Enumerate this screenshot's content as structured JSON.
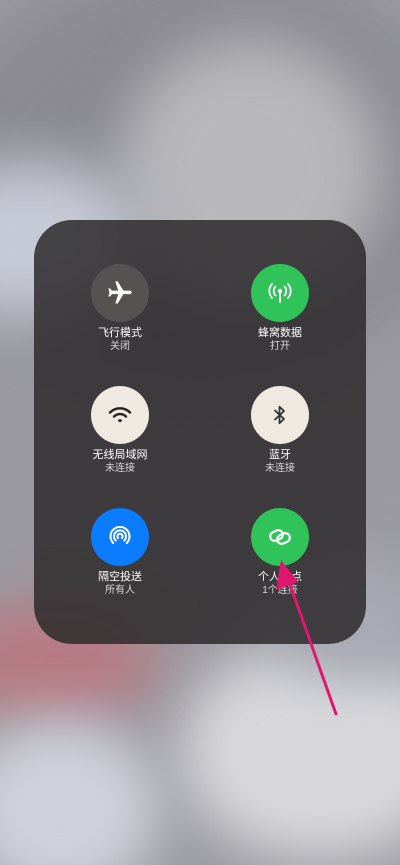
{
  "colors": {
    "accent_green": "#2fc35a",
    "accent_blue": "#0a7cff",
    "light_tile": "#efe9e1",
    "dark_tile": "#555352",
    "annotation_arrow": "#e0176e"
  },
  "tiles": [
    {
      "label": "飞行模式",
      "status": "关闭",
      "icon": "airplane-icon"
    },
    {
      "label": "蜂窝数据",
      "status": "打开",
      "icon": "cellular-antenna-icon"
    },
    {
      "label": "无线局域网",
      "status": "未连接",
      "icon": "wifi-icon"
    },
    {
      "label": "蓝牙",
      "status": "未连接",
      "icon": "bluetooth-icon"
    },
    {
      "label": "隔空投送",
      "status": "所有人",
      "icon": "airdrop-icon"
    },
    {
      "label": "个人热点",
      "status": "1个连接",
      "icon": "hotspot-link-icon"
    }
  ]
}
